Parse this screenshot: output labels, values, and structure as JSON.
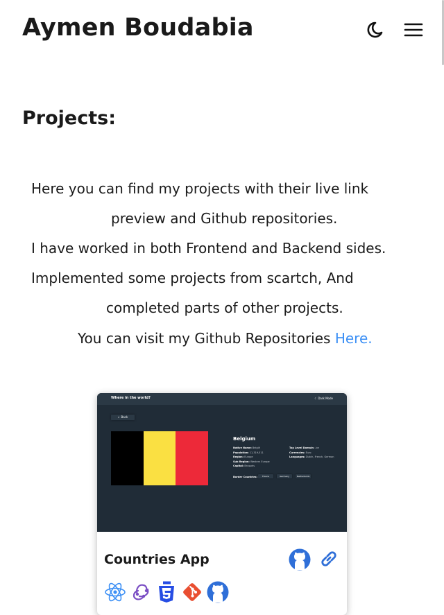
{
  "header": {
    "site_title": "Aymen Boudabia",
    "theme_toggle_icon": "moon-icon",
    "menu_icon": "hamburger-menu-icon"
  },
  "projects_section": {
    "title": "Projects:",
    "intro_lines": [
      "Here you can find my projects with their live link",
      "preview and Github repositories.",
      "I have worked in both Frontend and Backend sides.",
      "Implemented some projects from scartch, And",
      "completed parts of other projects."
    ],
    "visit_text": "You can visit my Github Repositories ",
    "visit_link_label": "Here.",
    "link_color": "#3b8ff5"
  },
  "project_card": {
    "title": "Countries App",
    "github_icon": "github-icon",
    "live_link_icon": "link-icon",
    "tech_icons": [
      "react-icon",
      "redux-icon",
      "css3-icon",
      "git-icon",
      "github-icon"
    ],
    "preview": {
      "app_title": "Where in the world?",
      "mode_label": "Dark Mode",
      "back_label": "Back",
      "country_name": "Belgium",
      "left_details": [
        {
          "key": "Native Name:",
          "value": "België"
        },
        {
          "key": "Population:",
          "value": "11,319,511"
        },
        {
          "key": "Region:",
          "value": "Europe"
        },
        {
          "key": "Sub Region:",
          "value": "Western Europe"
        },
        {
          "key": "Capital:",
          "value": "Brussels"
        }
      ],
      "right_details": [
        {
          "key": "Top Level Domain:",
          "value": ".be"
        },
        {
          "key": "Currencies:",
          "value": "Euro"
        },
        {
          "key": "Languages:",
          "value": "Dutch, French, German"
        }
      ],
      "border_label": "Border Countries:",
      "border_countries": [
        "France",
        "Germany",
        "Netherlands"
      ],
      "flag_colors": [
        "#000000",
        "#fae042",
        "#ed2939"
      ]
    }
  },
  "colors": {
    "text": "#1a1a1a",
    "accent_blue": "#2f6fd8",
    "preview_bg": "#202c37"
  }
}
